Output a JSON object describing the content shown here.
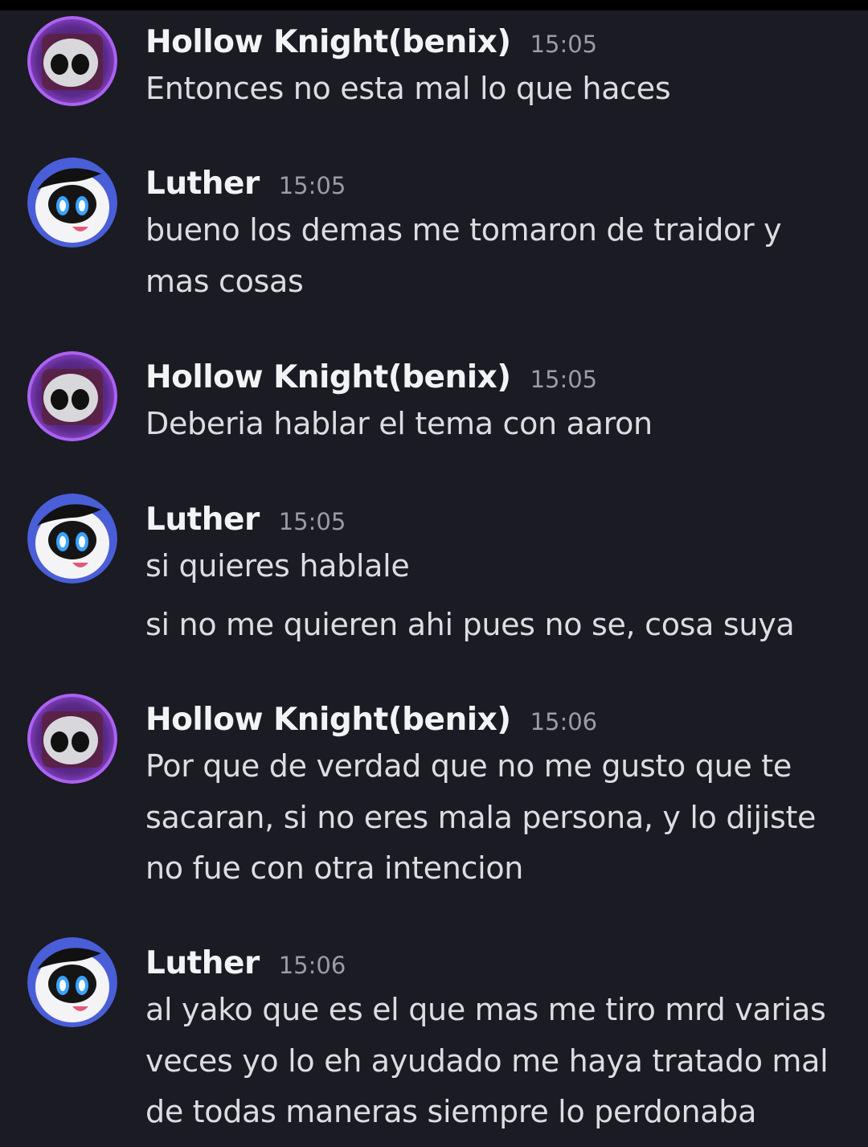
{
  "messages": [
    {
      "author": "Hollow Knight(benix)",
      "avatar_icon": "hollow-knight-avatar",
      "time": "15:05",
      "lines": [
        "Entonces no esta mal lo que haces"
      ]
    },
    {
      "author": "Luther",
      "avatar_icon": "luther-avatar",
      "time": "15:05",
      "lines": [
        "bueno los demas me tomaron de traidor y",
        "mas cosas"
      ]
    },
    {
      "author": "Hollow Knight(benix)",
      "avatar_icon": "hollow-knight-avatar",
      "time": "15:05",
      "lines": [
        "Deberia hablar el tema con aaron"
      ]
    },
    {
      "author": "Luther",
      "avatar_icon": "luther-avatar",
      "time": "15:05",
      "lines": [
        "si quieres hablale",
        "si no me quieren ahi pues no se, cosa suya"
      ]
    },
    {
      "author": "Hollow Knight(benix)",
      "avatar_icon": "hollow-knight-avatar",
      "time": "15:06",
      "lines": [
        "Por que de verdad que no me gusto que te",
        "sacaran, si no eres mala persona, y lo dijiste",
        "no fue con otra intencion"
      ]
    },
    {
      "author": "Luther",
      "avatar_icon": "luther-avatar",
      "time": "15:06",
      "lines": [
        "al yako que es el que mas me tiro mrd varias",
        "veces yo lo eh ayudado me haya tratado mal",
        "de todas maneras siempre lo perdonaba"
      ]
    }
  ],
  "colors": {
    "background": "#1a1b23",
    "author": "#f2f3f5",
    "timestamp": "#9a9ca6",
    "text": "#dcdde2"
  }
}
